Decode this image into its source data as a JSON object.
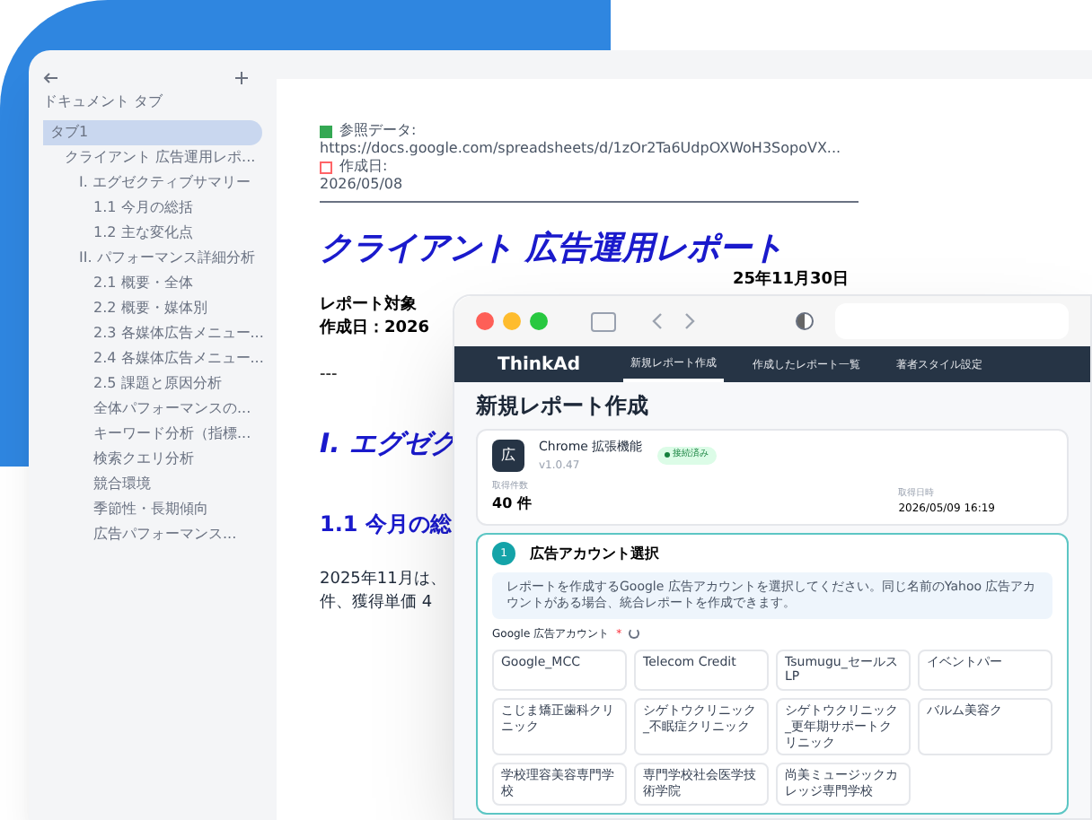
{
  "doc_sidebar": {
    "header": "ドキュメント タブ",
    "items": [
      {
        "label": "タブ1",
        "selected": true,
        "children": [
          {
            "label": "クライアント 広告運用レポ...",
            "selected": false,
            "children": [
              {
                "label": "I. エグゼクティブサマリー",
                "selected": false,
                "children": [
                  {
                    "label": "1.1 今月の総括",
                    "selected": false
                  },
                  {
                    "label": "1.2 主な変化点",
                    "selected": false
                  }
                ]
              },
              {
                "label": "II. パフォーマンス詳細分析",
                "selected": false,
                "children": [
                  {
                    "label": "2.1 概要・全体",
                    "selected": false
                  },
                  {
                    "label": "2.2 概要・媒体別",
                    "selected": false
                  },
                  {
                    "label": "2.3 各媒体広告メニュー...",
                    "selected": false
                  },
                  {
                    "label": "2.4 各媒体広告メニュー...",
                    "selected": false
                  },
                  {
                    "label": "2.5 課題と原因分析",
                    "selected": false
                  },
                  {
                    "label": "全体パフォーマンスの...",
                    "selected": false
                  },
                  {
                    "label": "キーワード分析（指標...",
                    "selected": false
                  },
                  {
                    "label": "検索クエリ分析",
                    "selected": false
                  },
                  {
                    "label": "競合環境",
                    "selected": false
                  },
                  {
                    "label": "季節性・長期傾向",
                    "selected": false
                  },
                  {
                    "label": "広告パフォーマンス...",
                    "selected": false
                  }
                ]
              }
            ]
          }
        ]
      }
    ]
  },
  "document": {
    "ref_label": "参照データ:",
    "ref_url": "https://docs.google.com/spreadsheets/d/1zOr2Ta6UdpOXWoH3SopoVX...",
    "date_label": "作成日:",
    "date": "2026/05/08",
    "title": "クライアント 広告運用レポート",
    "period_tail": "25年11月30日",
    "meta": [
      "レポート対象",
      "作成日：2026"
    ],
    "separator": "---",
    "h1": "I. エグゼク",
    "h2": "1.1 今月の総",
    "paragraph": [
      "2025年11月は、",
      "件、獲得単価 4"
    ]
  },
  "app_window": {
    "brand": "ThinkAd",
    "tabs": [
      {
        "label": "新規レポート作成",
        "selected": true
      },
      {
        "label": "作成したレポート一覧",
        "selected": false
      },
      {
        "label": "著者スタイル設定",
        "selected": false
      }
    ],
    "heading": "新規レポート作成",
    "extension": {
      "icon_text": "広",
      "name": "Chrome 拡張機能",
      "version": "v1.0.47",
      "status": "接続済み",
      "count_label": "取得件数",
      "count": "40 件",
      "time_label": "取得日時",
      "time": "2026/05/09 16:19"
    },
    "section": {
      "number": "1",
      "title": "広告アカウント選択",
      "info": "レポートを作成するGoogle 広告アカウントを選択してください。同じ名前のYahoo 広告アカウントがある場合、統合レポートを作成できます。",
      "field_label": "Google 広告アカウント",
      "required_mark": "*",
      "accounts": [
        "Google_MCC",
        "Telecom Credit",
        "Tsumugu_セールスLP",
        "イベントパー",
        "こじま矯正歯科クリニック",
        "シゲトウクリニック_不眠症クリニック",
        "シゲトウクリニック_更年期サポートクリニック",
        "バルム美容ク",
        "学校理容美容専門学校",
        "専門学校社会医学技術学院",
        "尚美ミュージックカレッジ専門学校"
      ]
    }
  }
}
